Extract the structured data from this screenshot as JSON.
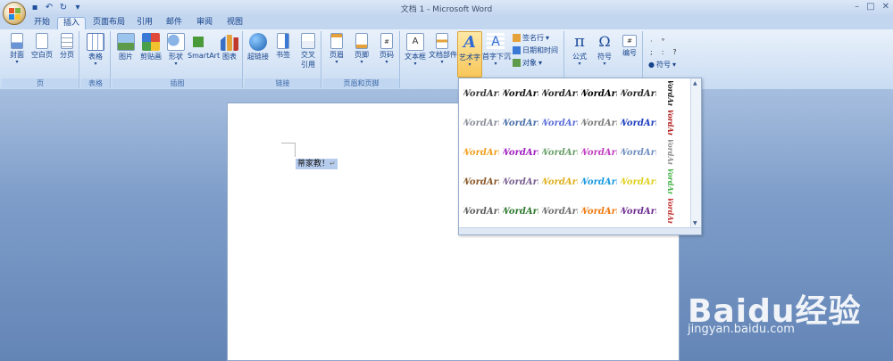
{
  "window": {
    "title": "文档 1 - Microsoft Word"
  },
  "quick_access": [
    "save-icon",
    "undo-icon",
    "redo-icon",
    "customize-icon"
  ],
  "tabs": [
    {
      "label": "开始"
    },
    {
      "label": "插入"
    },
    {
      "label": "页面布局"
    },
    {
      "label": "引用"
    },
    {
      "label": "邮件"
    },
    {
      "label": "审阅"
    },
    {
      "label": "视图"
    }
  ],
  "active_tab": "插入",
  "ribbon": {
    "pages": {
      "label": "页",
      "cover": "封面",
      "blank": "空白页",
      "break": "分页"
    },
    "tables": {
      "label": "表格",
      "table": "表格"
    },
    "illustrations": {
      "label": "插图",
      "picture": "图片",
      "clipart": "剪贴画",
      "shapes": "形状",
      "smartart": "SmartArt",
      "chart": "图表"
    },
    "links": {
      "label": "链接",
      "hyperlink": "超链接",
      "bookmark": "书签",
      "crossref_1": "交叉",
      "crossref_2": "引用"
    },
    "header_footer": {
      "label": "页眉和页脚",
      "header": "页眉",
      "footer": "页脚",
      "pagenum": "页码"
    },
    "text": {
      "textbox": "文本框",
      "quickparts": "文档部件",
      "wordart": "艺术字",
      "dropcap": "首字下沉",
      "signature": "签名行",
      "datetime": "日期和时间",
      "object": "对象"
    },
    "symbols": {
      "equation": "公式",
      "symbol": "符号",
      "numbering": "编号",
      "symbol2": "符号"
    }
  },
  "document": {
    "text": "蒂家教！",
    "paragraph_mark": "↵"
  },
  "wordart_gallery": {
    "sample": "WordArt",
    "colors": [
      "#3a3a3a",
      "#111111",
      "#222222",
      "#000000",
      "#2b2b2b",
      "#1a1a1a",
      "#8a8f99",
      "#4a6fa8",
      "#5b6ed8",
      "#7d7d7d",
      "#1f3fbf",
      "#b01c1c",
      "#f0a020",
      "#a020c0",
      "#6a9f6a",
      "#c040c0",
      "#7090c0",
      "#8a8a8a",
      "#8b5a2b",
      "#7a6090",
      "#e0b020",
      "#1a9ae0",
      "#e0d020",
      "#40b040",
      "#606060",
      "#2f7a2f",
      "#707070",
      "#f07a10",
      "#703090",
      "#c03030"
    ]
  },
  "watermark": {
    "brand": "Baidu经验",
    "url": "jingyan.baidu.com"
  }
}
